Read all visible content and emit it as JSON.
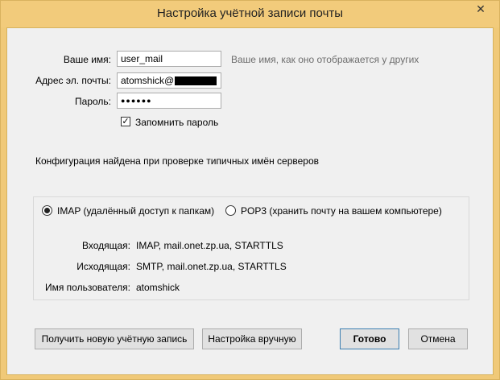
{
  "window": {
    "title": "Настройка учётной записи почты",
    "close_glyph": "✕"
  },
  "form": {
    "name_label": "Ваше имя:",
    "name_value": "user_mail",
    "name_hint": "Ваше имя, как оно отображается у других",
    "email_label": "Адрес эл. почты:",
    "email_value": "atomshick@",
    "password_label": "Пароль:",
    "password_value": "●●●●●●",
    "remember_label": "Запомнить пароль",
    "remember_checked": "✓"
  },
  "status_message": "Конфигурация найдена при проверке типичных имён серверов",
  "protocol": {
    "imap_label": "IMAP (удалённый доступ к папкам)",
    "pop3_label": "POP3 (хранить почту на вашем компьютере)",
    "selected": "IMAP"
  },
  "servers": {
    "incoming_label": "Входящая:",
    "incoming_value": "IMAP, mail.onet.zp.ua, STARTTLS",
    "outgoing_label": "Исходящая:",
    "outgoing_value": "SMTP, mail.onet.zp.ua, STARTTLS",
    "username_label": "Имя пользователя:",
    "username_value": "atomshick"
  },
  "buttons": {
    "get_new_account": "Получить новую учётную запись",
    "manual_config": "Настройка вручную",
    "done": "Готово",
    "cancel": "Отмена"
  }
}
